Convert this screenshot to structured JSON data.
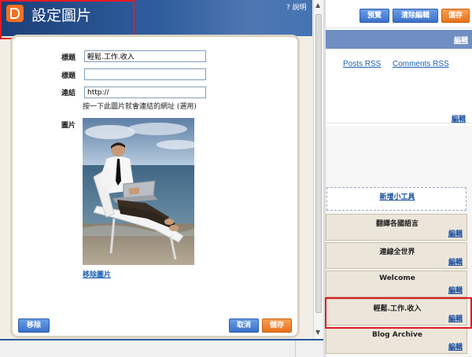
{
  "dialog": {
    "title": "設定圖片",
    "help": "? 說明",
    "fields": {
      "title_label": "標題",
      "title_value": "輕鬆.工作.收入",
      "caption_label": "標題",
      "caption_value": "",
      "link_label": "連結",
      "link_value": "http://",
      "link_hint": "按一下此圖片就會連結的網址 (選用)",
      "image_label": "圖片",
      "remove_image": "移除圖片"
    },
    "buttons": {
      "remove": "移除",
      "cancel": "取消",
      "save": "儲存"
    }
  },
  "right_panel": {
    "top_buttons": {
      "preview": "預覽",
      "clear_edits": "清除編輯",
      "save": "儲存"
    },
    "edit_label": "編輯",
    "rss_links": [
      "Posts RSS",
      "Comments RSS"
    ],
    "add_widget": "新增小工具",
    "widgets": [
      {
        "title": "翻譯各國語言",
        "edit": "編輯"
      },
      {
        "title": "連線全世界",
        "edit": "編輯"
      },
      {
        "title": "Welcome",
        "edit": "編輯"
      },
      {
        "title": "輕鬆.工作.收入",
        "edit": "編輯"
      },
      {
        "title": "Blog Archive",
        "edit": "編輯"
      }
    ]
  },
  "colors": {
    "header_blue": "#2d5a9a",
    "blogger_orange": "#f37021",
    "button_blue": "#3a71c9",
    "button_orange": "#e9701d",
    "highlight_red": "#e31b23",
    "link_blue": "#1a5fb4"
  },
  "icons": [
    "blogger-logo-icon",
    "help-icon",
    "scroll-up-icon",
    "scroll-down-icon"
  ]
}
